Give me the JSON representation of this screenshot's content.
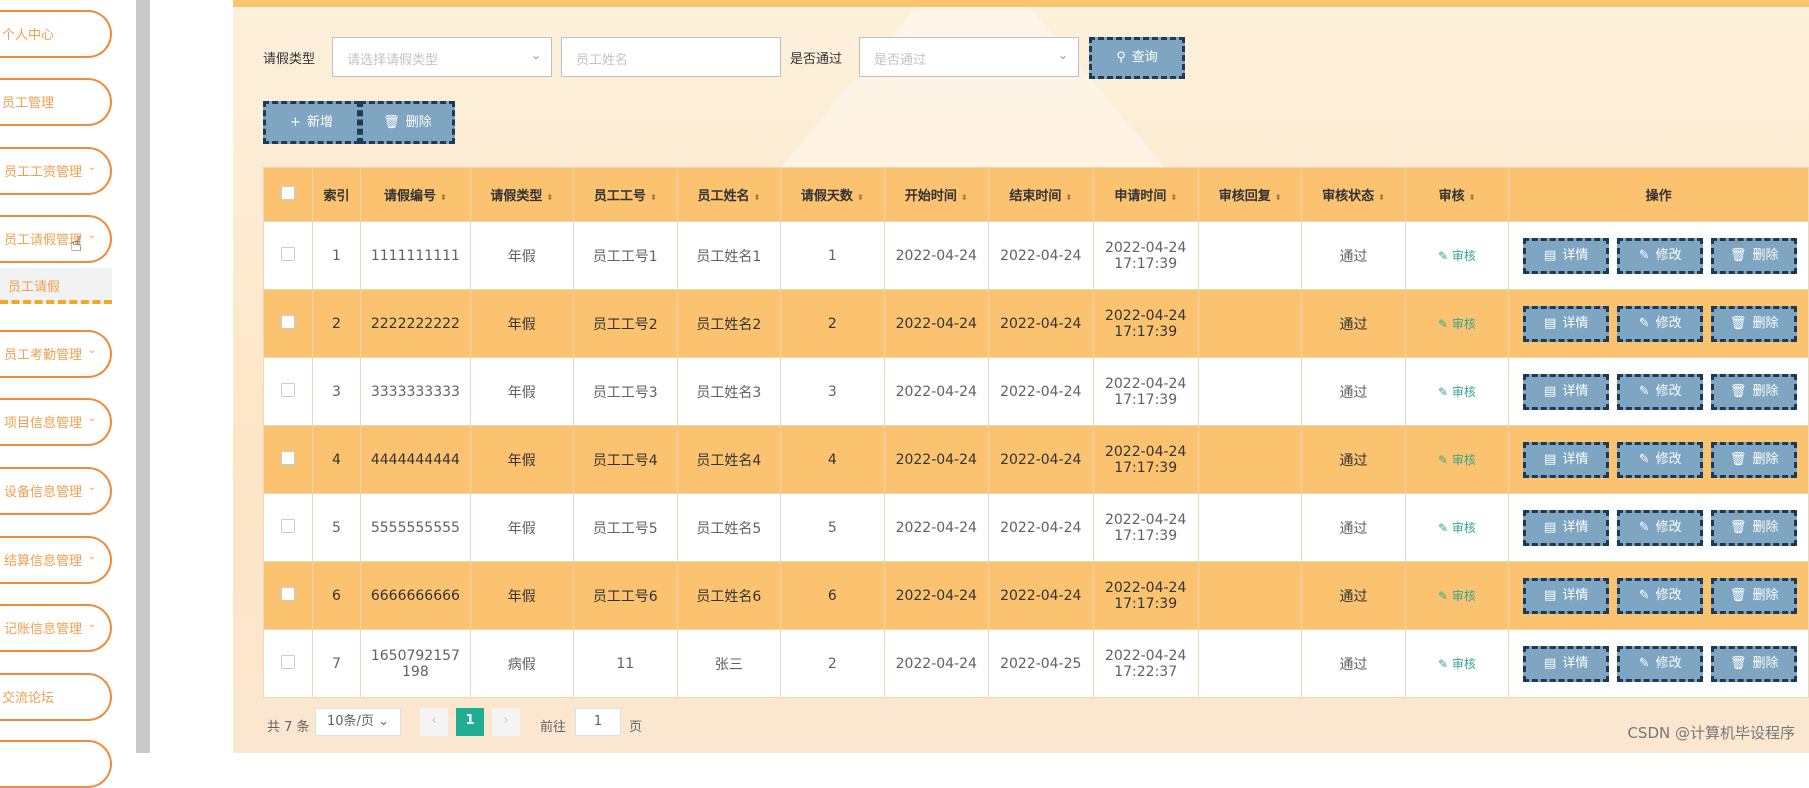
{
  "sidebar": {
    "items": [
      {
        "label": "个人中心",
        "chevron": ""
      },
      {
        "label": "员工管理",
        "chevron": ""
      },
      {
        "label": "员工工资管理",
        "chevron": "⌄"
      },
      {
        "label": "员工请假管理",
        "chevron": "⌄"
      },
      {
        "label": "员工考勤管理",
        "chevron": "⌄"
      },
      {
        "label": "项目信息管理",
        "chevron": "⌄"
      },
      {
        "label": "设备信息管理",
        "chevron": "⌄"
      },
      {
        "label": "结算信息管理",
        "chevron": "⌄"
      },
      {
        "label": "记账信息管理",
        "chevron": "⌄"
      },
      {
        "label": "交流论坛",
        "chevron": ""
      }
    ],
    "submenu_label": "员工请假"
  },
  "search": {
    "leave_type_label": "请假类型",
    "leave_type_placeholder": "请选择请假类型",
    "name_placeholder": "员工姓名",
    "passed_label": "是否通过",
    "passed_placeholder": "是否通过",
    "query_label": "查询"
  },
  "toolbar": {
    "add_label": "新增",
    "delete_label": "删除"
  },
  "table": {
    "headers": [
      "索引",
      "请假编号",
      "请假类型",
      "员工工号",
      "员工姓名",
      "请假天数",
      "开始时间",
      "结束时间",
      "申请时间",
      "审核回复",
      "审核状态",
      "审核",
      "操作"
    ],
    "rows": [
      {
        "idx": "1",
        "no": "1111111111",
        "no2": "",
        "type": "年假",
        "emp_no": "员工工号1",
        "name": "员工姓名1",
        "days": "1",
        "start": "2022-04-24",
        "end": "2022-04-24",
        "apply_date": "2022-04-24",
        "apply_time": "17:17:39",
        "reply": "",
        "status": "通过"
      },
      {
        "idx": "2",
        "no": "2222222222",
        "no2": "",
        "type": "年假",
        "emp_no": "员工工号2",
        "name": "员工姓名2",
        "days": "2",
        "start": "2022-04-24",
        "end": "2022-04-24",
        "apply_date": "2022-04-24",
        "apply_time": "17:17:39",
        "reply": "",
        "status": "通过"
      },
      {
        "idx": "3",
        "no": "3333333333",
        "no2": "",
        "type": "年假",
        "emp_no": "员工工号3",
        "name": "员工姓名3",
        "days": "3",
        "start": "2022-04-24",
        "end": "2022-04-24",
        "apply_date": "2022-04-24",
        "apply_time": "17:17:39",
        "reply": "",
        "status": "通过"
      },
      {
        "idx": "4",
        "no": "4444444444",
        "no2": "",
        "type": "年假",
        "emp_no": "员工工号4",
        "name": "员工姓名4",
        "days": "4",
        "start": "2022-04-24",
        "end": "2022-04-24",
        "apply_date": "2022-04-24",
        "apply_time": "17:17:39",
        "reply": "",
        "status": "通过"
      },
      {
        "idx": "5",
        "no": "5555555555",
        "no2": "",
        "type": "年假",
        "emp_no": "员工工号5",
        "name": "员工姓名5",
        "days": "5",
        "start": "2022-04-24",
        "end": "2022-04-24",
        "apply_date": "2022-04-24",
        "apply_time": "17:17:39",
        "reply": "",
        "status": "通过"
      },
      {
        "idx": "6",
        "no": "6666666666",
        "no2": "",
        "type": "年假",
        "emp_no": "员工工号6",
        "name": "员工姓名6",
        "days": "6",
        "start": "2022-04-24",
        "end": "2022-04-24",
        "apply_date": "2022-04-24",
        "apply_time": "17:17:39",
        "reply": "",
        "status": "通过"
      },
      {
        "idx": "7",
        "no": "1650792157",
        "no2": "198",
        "type": "病假",
        "emp_no": "11",
        "name": "张三",
        "days": "2",
        "start": "2022-04-24",
        "end": "2022-04-25",
        "apply_date": "2022-04-24",
        "apply_time": "17:22:37",
        "reply": "",
        "status": "通过"
      }
    ],
    "audit_label": "审核",
    "detail_label": "详情",
    "edit_label": "修改",
    "delete_label": "删除"
  },
  "pagination": {
    "total": "共 7 条",
    "page_size": "10条/页",
    "prev": "‹",
    "current": "1",
    "next": "›",
    "goto_prefix": "前往",
    "goto_value": "1",
    "goto_suffix": "页"
  },
  "watermark": "CSDN @计算机毕设程序",
  "colors": {
    "accent": "#fbc370",
    "button": "#7ea5c2",
    "active_page": "#1fae93"
  }
}
